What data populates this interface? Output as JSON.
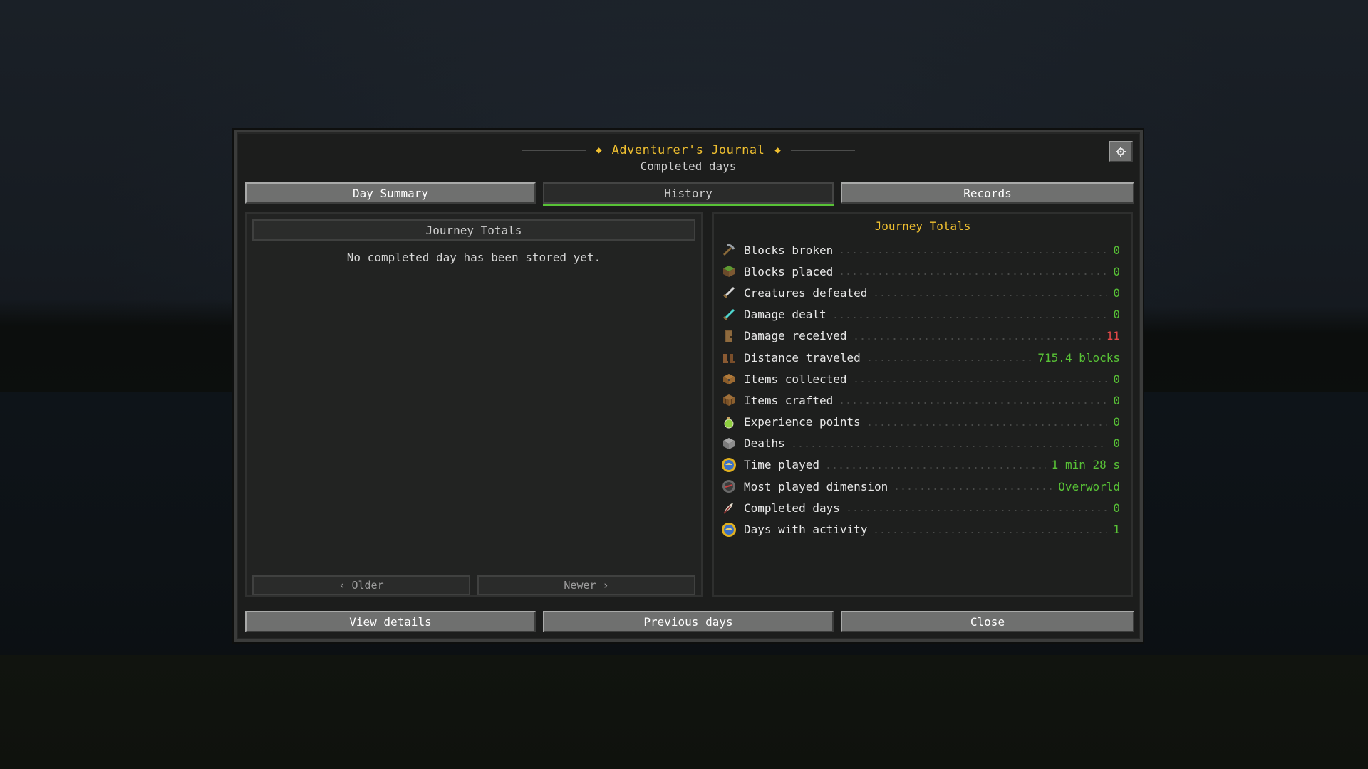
{
  "header": {
    "title": "Adventurer's Journal",
    "subtitle": "Completed days",
    "settings_icon": "gear-icon"
  },
  "tabs": [
    {
      "label": "Day Summary",
      "active": false
    },
    {
      "label": "History",
      "active": true
    },
    {
      "label": "Records",
      "active": false
    }
  ],
  "left_panel": {
    "header": "Journey Totals",
    "empty_message": "No completed day has been stored yet.",
    "older_label": "‹ Older",
    "newer_label": "Newer ›"
  },
  "right_panel": {
    "title": "Journey Totals",
    "stats": [
      {
        "label": "Blocks broken",
        "value": "0",
        "icon": "pickaxe-icon",
        "color": "#58c236"
      },
      {
        "label": "Blocks placed",
        "value": "0",
        "icon": "grass-block-icon",
        "color": "#58c236"
      },
      {
        "label": "Creatures defeated",
        "value": "0",
        "icon": "iron-sword-icon",
        "color": "#58c236"
      },
      {
        "label": "Damage dealt",
        "value": "0",
        "icon": "diamond-sword-icon",
        "color": "#58c236"
      },
      {
        "label": "Damage received",
        "value": "11",
        "icon": "wooden-door-icon",
        "color": "#e04848"
      },
      {
        "label": "Distance traveled",
        "value": "715.4 blocks",
        "icon": "boots-icon",
        "color": "#58c236"
      },
      {
        "label": "Items collected",
        "value": "0",
        "icon": "chest-icon",
        "color": "#58c236"
      },
      {
        "label": "Items crafted",
        "value": "0",
        "icon": "crafting-table-icon",
        "color": "#58c236"
      },
      {
        "label": "Experience points",
        "value": "0",
        "icon": "experience-bottle-icon",
        "color": "#58c236"
      },
      {
        "label": "Deaths",
        "value": "0",
        "icon": "stone-block-icon",
        "color": "#58c236"
      },
      {
        "label": "Time played",
        "value": "1 min 28 s",
        "icon": "clock-icon",
        "color": "#58c236"
      },
      {
        "label": "Most played dimension",
        "value": "Overworld",
        "icon": "compass-icon",
        "color": "#58c236"
      },
      {
        "label": "Completed days",
        "value": "0",
        "icon": "feather-quill-icon",
        "color": "#58c236"
      },
      {
        "label": "Days with activity",
        "value": "1",
        "icon": "clock-icon",
        "color": "#58c236"
      }
    ]
  },
  "footer": {
    "view_details": "View details",
    "previous_days": "Previous days",
    "close": "Close"
  },
  "colors": {
    "accent_gold": "#f0c030",
    "value_green": "#58c236",
    "value_red": "#e04848"
  }
}
